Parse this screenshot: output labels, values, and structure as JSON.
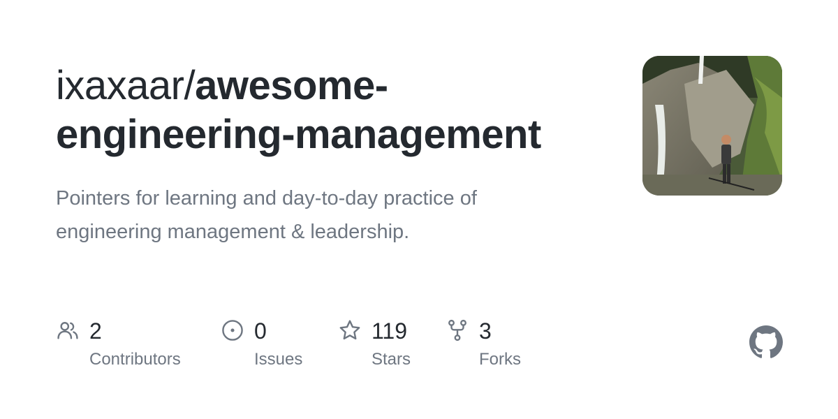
{
  "repo": {
    "owner": "ixaxaar/",
    "name": "awesome-engineering-management",
    "description": "Pointers for learning and day-to-day practice of engineering management & leadership."
  },
  "stats": [
    {
      "icon": "people-icon",
      "count": "2",
      "label": "Contributors"
    },
    {
      "icon": "issue-opened-icon",
      "count": "0",
      "label": "Issues"
    },
    {
      "icon": "star-icon",
      "count": "119",
      "label": "Stars"
    },
    {
      "icon": "repo-forked-icon",
      "count": "3",
      "label": "Forks"
    }
  ],
  "colors": {
    "text": "#24292f",
    "muted": "#6e7681",
    "logo": "#6e7681"
  },
  "avatar": {
    "icon": "avatar-photo"
  },
  "logo": {
    "icon": "github-mark-icon"
  }
}
